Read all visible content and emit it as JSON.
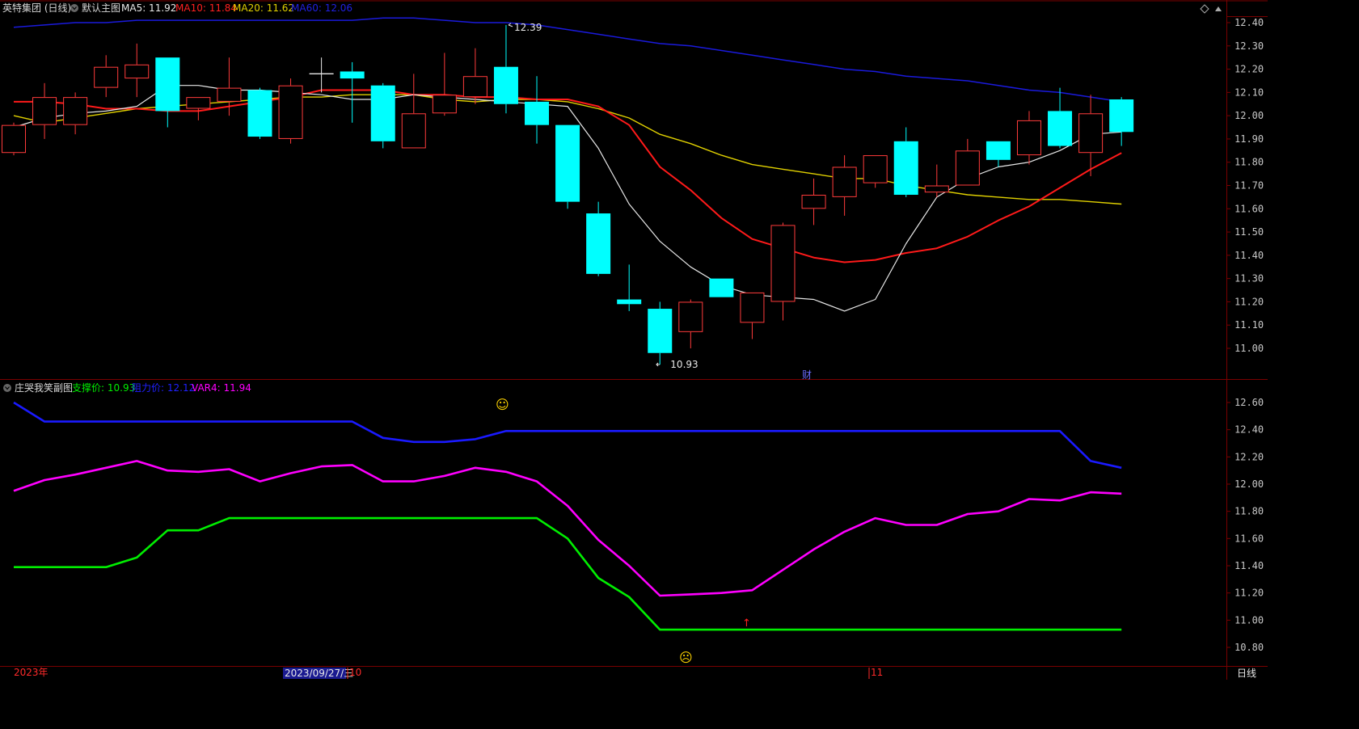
{
  "main_header": {
    "name": "英特集团 (日线)",
    "template": "默认主图",
    "ma5": "MA5: 11.92",
    "ma10": "MA10: 11.84",
    "ma20": "MA20: 11.62",
    "ma60": "MA60: 12.06"
  },
  "sub_header": {
    "name": "庄哭我笑副图",
    "support": "支撑价: 10.93",
    "resist": "阻力价: 12.12",
    "var4": "VAR4: 11.94"
  },
  "markers": {
    "hi_label": "12.39",
    "lo_label": "10.93",
    "fin_label": "财",
    "smile": "☺",
    "frown": "☹",
    "up_arrow": "↑"
  },
  "bottom_bar": {
    "year": "2023年",
    "cursor_date": "2023/09/27/三",
    "month_oct": "10",
    "month_nov": "11",
    "period": "日线"
  },
  "colors": {
    "up": "#ff3b3b",
    "down": "#00ffff",
    "ma5": "#e8e8e8",
    "ma10": "#ff1a1a",
    "ma20": "#e0d000",
    "ma60": "#1a1adc",
    "support": "#00ee00",
    "resist": "#1a1aff",
    "var4": "#ff00ff",
    "grid_border": "#7a0000"
  },
  "chart_data": [
    {
      "type": "candlestick",
      "title": "英特集团 (日线)",
      "ylim": [
        10.9,
        12.5
      ],
      "y_ticks": [
        "12.40",
        "12.30",
        "12.20",
        "12.10",
        "12.00",
        "11.90",
        "11.80",
        "11.70",
        "11.60",
        "11.50",
        "11.40",
        "11.30",
        "11.20",
        "11.10",
        "11.00"
      ],
      "ohlc": [
        [
          11.84,
          11.97,
          11.83,
          11.96
        ],
        [
          11.96,
          12.14,
          11.9,
          12.08
        ],
        [
          11.96,
          12.1,
          11.92,
          12.08
        ],
        [
          12.12,
          12.26,
          12.08,
          12.21
        ],
        [
          12.16,
          12.31,
          12.08,
          12.22
        ],
        [
          12.25,
          12.25,
          11.95,
          12.02
        ],
        [
          12.03,
          12.08,
          11.98,
          12.08
        ],
        [
          12.06,
          12.25,
          12.0,
          12.12
        ],
        [
          12.11,
          12.12,
          11.9,
          11.91
        ],
        [
          11.9,
          12.16,
          11.88,
          12.13
        ],
        [
          12.18,
          12.25,
          12.1,
          12.18
        ],
        [
          12.19,
          12.23,
          11.97,
          12.16
        ],
        [
          12.13,
          12.14,
          11.86,
          11.89
        ],
        [
          11.86,
          12.18,
          11.86,
          12.01
        ],
        [
          12.01,
          12.27,
          12.0,
          12.09
        ],
        [
          12.08,
          12.29,
          12.05,
          12.17
        ],
        [
          12.21,
          12.39,
          12.01,
          12.05
        ],
        [
          12.06,
          12.17,
          11.88,
          11.96
        ],
        [
          11.96,
          11.96,
          11.6,
          11.63
        ],
        [
          11.58,
          11.63,
          11.31,
          11.32
        ],
        [
          11.21,
          11.36,
          11.16,
          11.19
        ],
        [
          11.17,
          11.2,
          10.93,
          10.98
        ],
        [
          11.07,
          11.21,
          11.0,
          11.2
        ],
        [
          11.3,
          11.3,
          11.22,
          11.22
        ],
        [
          11.11,
          11.24,
          11.04,
          11.24
        ],
        [
          11.2,
          11.54,
          11.12,
          11.53
        ],
        [
          11.6,
          11.73,
          11.53,
          11.66
        ],
        [
          11.65,
          11.83,
          11.57,
          11.78
        ],
        [
          11.71,
          11.83,
          11.69,
          11.83
        ],
        [
          11.89,
          11.95,
          11.65,
          11.66
        ],
        [
          11.67,
          11.79,
          11.65,
          11.7
        ],
        [
          11.7,
          11.9,
          11.7,
          11.85
        ],
        [
          11.89,
          11.89,
          11.78,
          11.81
        ],
        [
          11.83,
          12.02,
          11.79,
          11.98
        ],
        [
          12.02,
          12.12,
          11.86,
          11.87
        ],
        [
          11.84,
          12.09,
          11.74,
          12.01
        ],
        [
          12.07,
          12.08,
          11.87,
          11.93
        ]
      ],
      "ma5": [
        11.95,
        11.99,
        12.01,
        12.02,
        12.04,
        12.13,
        12.13,
        12.11,
        12.11,
        12.1,
        12.09,
        12.07,
        12.07,
        12.09,
        12.08,
        12.07,
        12.06,
        12.05,
        12.04,
        11.86,
        11.62,
        11.46,
        11.35,
        11.27,
        11.23,
        11.22,
        11.21,
        11.16,
        11.21,
        11.45,
        11.65,
        11.73,
        11.78,
        11.8,
        11.85,
        11.92,
        11.93
      ],
      "ma10": [
        12.06,
        12.06,
        12.05,
        12.03,
        12.03,
        12.02,
        12.02,
        12.04,
        12.06,
        12.08,
        12.11,
        12.11,
        12.11,
        12.09,
        12.09,
        12.08,
        12.08,
        12.07,
        12.07,
        12.04,
        11.96,
        11.78,
        11.68,
        11.56,
        11.47,
        11.43,
        11.39,
        11.37,
        11.38,
        11.41,
        11.43,
        11.48,
        11.55,
        11.61,
        11.69,
        11.77,
        11.84
      ],
      "ma20": [
        12.0,
        11.97,
        11.99,
        12.01,
        12.03,
        12.04,
        12.05,
        12.06,
        12.07,
        12.08,
        12.08,
        12.09,
        12.09,
        12.09,
        12.07,
        12.06,
        12.07,
        12.07,
        12.06,
        12.03,
        11.99,
        11.92,
        11.88,
        11.83,
        11.79,
        11.77,
        11.75,
        11.73,
        11.73,
        11.7,
        11.68,
        11.66,
        11.65,
        11.64,
        11.64,
        11.63,
        11.62
      ],
      "ma60": [
        12.38,
        12.39,
        12.4,
        12.4,
        12.41,
        12.41,
        12.41,
        12.41,
        12.41,
        12.41,
        12.41,
        12.41,
        12.42,
        12.42,
        12.41,
        12.4,
        12.4,
        12.39,
        12.37,
        12.35,
        12.33,
        12.31,
        12.3,
        12.28,
        12.26,
        12.24,
        12.22,
        12.2,
        12.19,
        12.17,
        12.16,
        12.15,
        12.13,
        12.11,
        12.1,
        12.08,
        12.06
      ]
    },
    {
      "type": "line",
      "title": "庄哭我笑副图",
      "ylim": [
        10.78,
        12.7
      ],
      "y_ticks": [
        "12.60",
        "12.40",
        "12.20",
        "12.00",
        "11.80",
        "11.60",
        "11.40",
        "11.20",
        "11.00",
        "10.80"
      ],
      "series": [
        {
          "name": "支撑价",
          "values": [
            11.39,
            11.39,
            11.39,
            11.39,
            11.46,
            11.66,
            11.66,
            11.75,
            11.75,
            11.75,
            11.75,
            11.75,
            11.75,
            11.75,
            11.75,
            11.75,
            11.75,
            11.75,
            11.6,
            11.31,
            11.17,
            10.93,
            10.93,
            10.93,
            10.93,
            10.93,
            10.93,
            10.93,
            10.93,
            10.93,
            10.93,
            10.93,
            10.93,
            10.93,
            10.93,
            10.93,
            10.93
          ]
        },
        {
          "name": "阻力价",
          "values": [
            12.6,
            12.46,
            12.46,
            12.46,
            12.46,
            12.46,
            12.46,
            12.46,
            12.46,
            12.46,
            12.46,
            12.46,
            12.34,
            12.31,
            12.31,
            12.33,
            12.39,
            12.39,
            12.39,
            12.39,
            12.39,
            12.39,
            12.39,
            12.39,
            12.39,
            12.39,
            12.39,
            12.39,
            12.39,
            12.39,
            12.39,
            12.39,
            12.39,
            12.39,
            12.39,
            12.17,
            12.12
          ]
        },
        {
          "name": "VAR4",
          "values": [
            11.95,
            12.03,
            12.07,
            12.12,
            12.17,
            12.1,
            12.09,
            12.11,
            12.02,
            12.08,
            12.13,
            12.14,
            12.02,
            12.02,
            12.06,
            12.12,
            12.09,
            12.02,
            11.84,
            11.59,
            11.4,
            11.18,
            11.19,
            11.2,
            11.22,
            11.37,
            11.52,
            11.65,
            11.75,
            11.7,
            11.7,
            11.78,
            11.8,
            11.89,
            11.88,
            11.94,
            11.93
          ]
        }
      ]
    }
  ]
}
